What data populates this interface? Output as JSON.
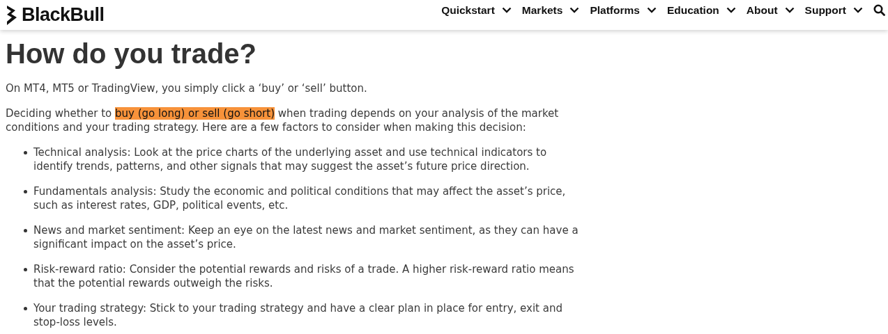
{
  "header": {
    "logo": "BlackBull",
    "nav": [
      {
        "label": "Quickstart"
      },
      {
        "label": "Markets"
      },
      {
        "label": "Platforms"
      },
      {
        "label": "Education"
      },
      {
        "label": "About"
      },
      {
        "label": "Support"
      }
    ]
  },
  "article": {
    "title": "How do you trade?",
    "intro": "On MT4, MT5 or TradingView, you simply click a ‘buy’ or ‘sell’ button.",
    "decision": {
      "text_before": "Deciding whether to ",
      "highlight": "buy (go long) or sell (go short)",
      "text_after": " when trading depends on your analysis of the market conditions and your trading strategy. Here are a few factors to consider when making this decision:"
    },
    "factors": [
      "Technical analysis: Look at the price charts of the underlying asset and use technical indicators to identify trends, patterns, and other signals that may suggest the asset’s future price direction.",
      "Fundamentals analysis: Study the economic and political conditions that may affect the asset’s price, such as interest rates, GDP, political events, etc.",
      "News and market sentiment: Keep an eye on the latest news and market sentiment, as they can have a significant impact on the asset’s price.",
      "Risk-reward ratio: Consider the potential rewards and risks of a trade. A higher risk-reward ratio means that the potential rewards outweigh the risks.",
      "Your trading strategy: Stick to your trading strategy and have a clear plan in place for entry, exit and stop-loss levels."
    ]
  }
}
